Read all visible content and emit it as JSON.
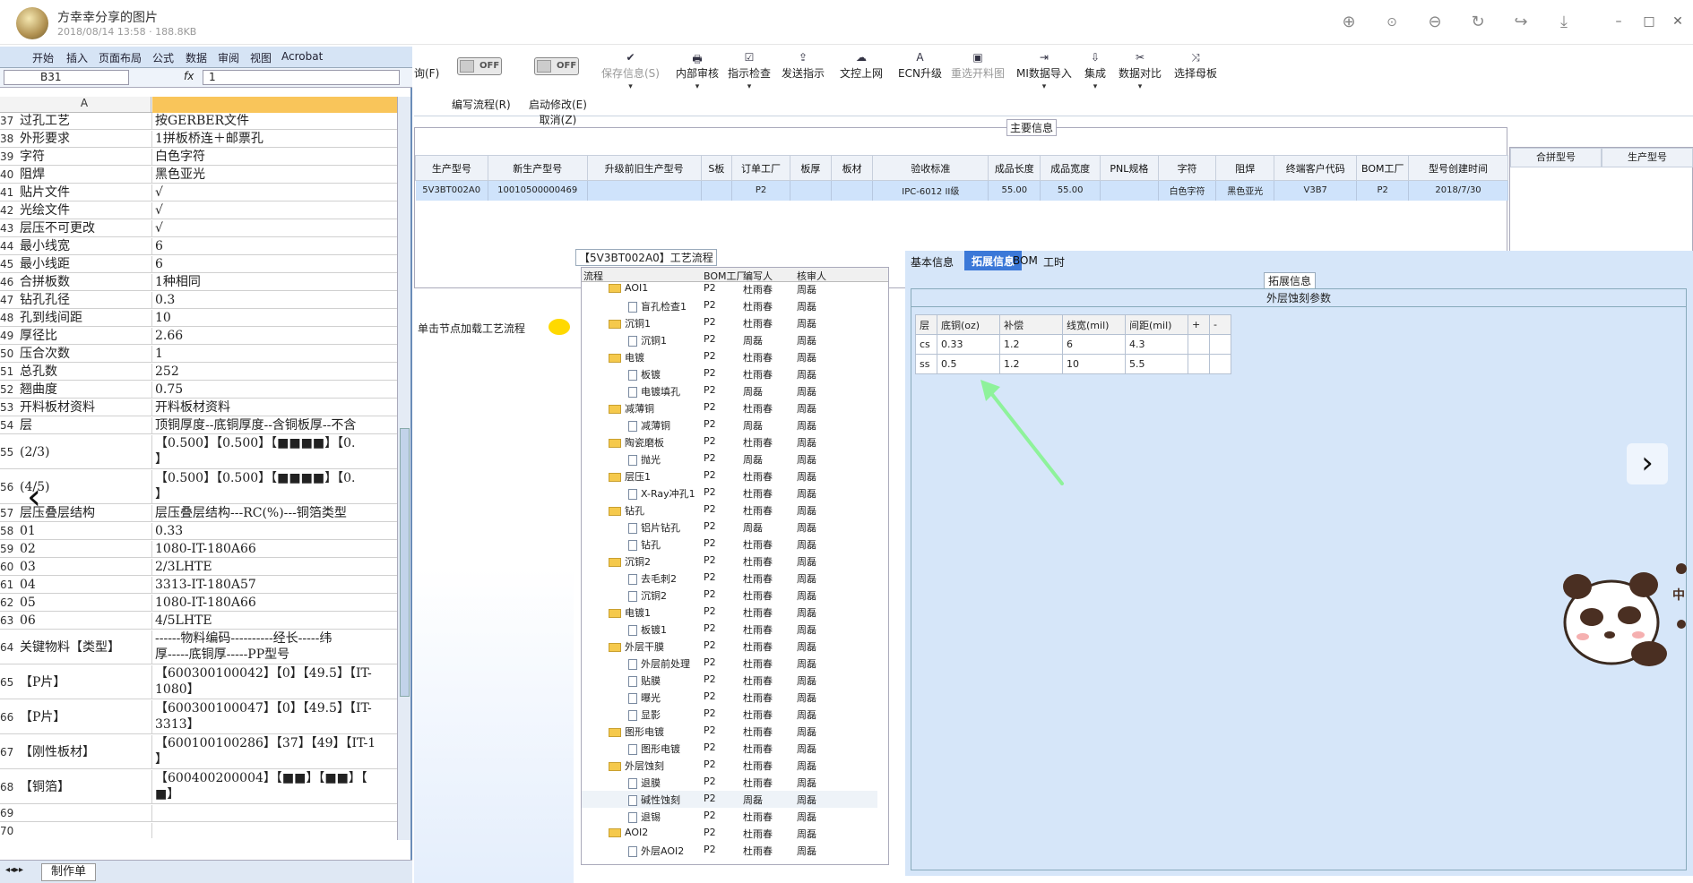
{
  "viewer": {
    "title": "方幸幸分享的图片",
    "meta": "2018/08/14 13:58 · 188.8KB"
  },
  "excel": {
    "ribbon_tabs": [
      "开始",
      "插入",
      "页面布局",
      "公式",
      "数据",
      "审阅",
      "视图",
      "Acrobat"
    ],
    "name_box": "B31",
    "fx": "fx",
    "formula_value": "1",
    "col_a": "A",
    "sheet_tab": "制作单",
    "rows": [
      {
        "n": "37",
        "a": "过孔工艺",
        "b": "按GERBER文件",
        "h": 19
      },
      {
        "n": "38",
        "a": "外形要求",
        "b": "1拼板桥连＋邮票孔",
        "h": 19
      },
      {
        "n": "39",
        "a": "字符",
        "b": "白色字符",
        "h": 19
      },
      {
        "n": "40",
        "a": "阻焊",
        "b": "黑色亚光",
        "h": 19
      },
      {
        "n": "41",
        "a": "贴片文件",
        "b": "√",
        "h": 19
      },
      {
        "n": "42",
        "a": "光绘文件",
        "b": "√",
        "h": 19
      },
      {
        "n": "43",
        "a": "层压不可更改",
        "b": "√",
        "h": 19
      },
      {
        "n": "44",
        "a": "最小线宽",
        "b": "6",
        "h": 19
      },
      {
        "n": "45",
        "a": "最小线距",
        "b": "6",
        "h": 19
      },
      {
        "n": "46",
        "a": "合拼板数",
        "b": "1种相同",
        "h": 19
      },
      {
        "n": "47",
        "a": "钻孔孔径",
        "b": "0.3",
        "h": 19
      },
      {
        "n": "48",
        "a": "孔到线间距",
        "b": "10",
        "h": 19
      },
      {
        "n": "49",
        "a": "厚径比",
        "b": "2.66",
        "h": 19
      },
      {
        "n": "50",
        "a": "压合次数",
        "b": "1",
        "h": 19
      },
      {
        "n": "51",
        "a": "总孔数",
        "b": "252",
        "h": 19
      },
      {
        "n": "52",
        "a": "翘曲度",
        "b": "0.75",
        "h": 19
      },
      {
        "n": "53",
        "a": "开料板材资料",
        "b": "开料板材资料",
        "h": 19
      },
      {
        "n": "54",
        "a": "层",
        "b": "顶铜厚度--底铜厚度--含铜板厚--不含",
        "h": 19
      },
      {
        "n": "55",
        "a": "(2/3)",
        "b": "【0.500】【0.500】【■■■■】【0.\n】",
        "h": 38
      },
      {
        "n": "56",
        "a": "(4/5)",
        "b": "【0.500】【0.500】【■■■■】【0.\n】",
        "h": 38
      },
      {
        "n": "57",
        "a": "层压叠层结构",
        "b": "层压叠层结构---RC(%)---铜箔类型",
        "h": 19
      },
      {
        "n": "58",
        "a": "01",
        "b": "0.33",
        "h": 19
      },
      {
        "n": "59",
        "a": "02",
        "b": "1080-IT-180A66",
        "h": 19
      },
      {
        "n": "60",
        "a": "03",
        "b": "2/3LHTE",
        "h": 19
      },
      {
        "n": "61",
        "a": "04",
        "b": "3313-IT-180A57",
        "h": 19
      },
      {
        "n": "62",
        "a": "05",
        "b": "1080-IT-180A66",
        "h": 19
      },
      {
        "n": "63",
        "a": "06",
        "b": "4/5LHTE",
        "h": 19
      },
      {
        "n": "64",
        "a": "关键物料【类型】",
        "b": "------物料编码----------经长-----纬\n厚-----底铜厚-----PP型号",
        "h": 38
      },
      {
        "n": "65",
        "a": "【P片】",
        "b": "【600300100042】【0】【49.5】【IT-\n1080】",
        "h": 38
      },
      {
        "n": "66",
        "a": "【P片】",
        "b": "【600300100047】【0】【49.5】【IT-\n3313】",
        "h": 38
      },
      {
        "n": "67",
        "a": "【刚性板材】",
        "b": "【600100100286】【37】【49】【IT-1\n】",
        "h": 38
      },
      {
        "n": "68",
        "a": "【铜箔】",
        "b": "【600400200004】【■■】【■■】【\n■】",
        "h": 38
      },
      {
        "n": "69",
        "a": "",
        "b": "",
        "h": 19
      },
      {
        "n": "70",
        "a": "",
        "b": "",
        "h": 19
      },
      {
        "n": "71",
        "a": "",
        "b": "",
        "h": 19
      },
      {
        "n": "72",
        "a": "",
        "b": "",
        "h": 19
      },
      {
        "n": "73",
        "a": "",
        "b": "",
        "h": 19
      }
    ]
  },
  "toolbar": {
    "buttons": [
      {
        "label": "询(F)",
        "icon": "",
        "disabled": false,
        "dd": false
      },
      {
        "label": "编写流程(R)",
        "icon": "",
        "disabled": false,
        "dd": false
      },
      {
        "label": "启动修改(E)",
        "label2": "取消(Z)",
        "icon": "",
        "disabled": false,
        "dd": false
      },
      {
        "label": "保存信息(S)",
        "icon": "✔",
        "disabled": true,
        "dd": true
      },
      {
        "label": "内部审核",
        "icon": "🖶",
        "disabled": false,
        "dd": true
      },
      {
        "label": "指示检查",
        "icon": "☑",
        "disabled": false,
        "dd": true
      },
      {
        "label": "发送指示",
        "icon": "⇪",
        "disabled": false,
        "dd": false
      },
      {
        "label": "文控上网",
        "icon": "☁",
        "disabled": false,
        "dd": false
      },
      {
        "label": "ECN升级",
        "icon": "A",
        "disabled": false,
        "dd": false
      },
      {
        "label": "重选开料图",
        "icon": "▣",
        "disabled": true,
        "dd": false
      },
      {
        "label": "MI数据导入",
        "icon": "⇥",
        "disabled": false,
        "dd": true
      },
      {
        "label": "集成",
        "icon": "⇩",
        "disabled": false,
        "dd": true
      },
      {
        "label": "数据对比",
        "icon": "✂",
        "disabled": false,
        "dd": true
      },
      {
        "label": "选择母板",
        "icon": "⤨",
        "disabled": false,
        "dd": false
      }
    ],
    "toggle_off": "OFF"
  },
  "main_info": {
    "title": "主要信息",
    "headers": [
      "生产型号",
      "新生产型号",
      "升级前旧生产型号",
      "S板",
      "订单工厂",
      "板厚",
      "板材",
      "验收标准",
      "成品长度",
      "成品宽度",
      "PNL规格",
      "字符",
      "阻焊",
      "终端客户代码",
      "BOM工厂",
      "型号创建时间"
    ],
    "row": [
      "5V3BT002A0",
      "10010500000469",
      "",
      "",
      "P2",
      "",
      "",
      "IPC-6012 II级",
      "55.00",
      "55.00",
      "",
      "白色字符",
      "黑色亚光",
      "V3B7",
      "P2",
      "2018/7/30"
    ],
    "side_headers": [
      "合拼型号",
      "生产型号"
    ]
  },
  "flow": {
    "hint": "单击节点加载工艺流程",
    "title": "【5V3BT002A0】工艺流程",
    "headers": [
      "流程",
      "BOM工厂",
      "编写人",
      "核审人"
    ],
    "rows": [
      {
        "t": "f",
        "l": "AOI1",
        "b": "P2",
        "w": "杜雨春",
        "r": "周磊"
      },
      {
        "t": "d",
        "l": "盲孔检查1",
        "b": "P2",
        "w": "杜雨春",
        "r": "周磊"
      },
      {
        "t": "f",
        "l": "沉铜1",
        "b": "P2",
        "w": "杜雨春",
        "r": "周磊"
      },
      {
        "t": "d",
        "l": "沉铜1",
        "b": "P2",
        "w": "周磊",
        "r": "周磊"
      },
      {
        "t": "f",
        "l": "电镀",
        "b": "P2",
        "w": "杜雨春",
        "r": "周磊"
      },
      {
        "t": "d",
        "l": "板镀",
        "b": "P2",
        "w": "杜雨春",
        "r": "周磊"
      },
      {
        "t": "d",
        "l": "电镀填孔",
        "b": "P2",
        "w": "周磊",
        "r": "周磊"
      },
      {
        "t": "f",
        "l": "减薄铜",
        "b": "P2",
        "w": "杜雨春",
        "r": "周磊"
      },
      {
        "t": "d",
        "l": "减薄铜",
        "b": "P2",
        "w": "周磊",
        "r": "周磊"
      },
      {
        "t": "f",
        "l": "陶瓷磨板",
        "b": "P2",
        "w": "杜雨春",
        "r": "周磊"
      },
      {
        "t": "d",
        "l": "抛光",
        "b": "P2",
        "w": "周磊",
        "r": "周磊"
      },
      {
        "t": "f",
        "l": "层压1",
        "b": "P2",
        "w": "杜雨春",
        "r": "周磊"
      },
      {
        "t": "d",
        "l": "X-Ray冲孔1",
        "b": "P2",
        "w": "杜雨春",
        "r": "周磊"
      },
      {
        "t": "f",
        "l": "钻孔",
        "b": "P2",
        "w": "杜雨春",
        "r": "周磊"
      },
      {
        "t": "d",
        "l": "铝片钻孔",
        "b": "P2",
        "w": "周磊",
        "r": "周磊"
      },
      {
        "t": "d",
        "l": "钻孔",
        "b": "P2",
        "w": "杜雨春",
        "r": "周磊"
      },
      {
        "t": "f",
        "l": "沉铜2",
        "b": "P2",
        "w": "杜雨春",
        "r": "周磊"
      },
      {
        "t": "d",
        "l": "去毛刺2",
        "b": "P2",
        "w": "杜雨春",
        "r": "周磊"
      },
      {
        "t": "d",
        "l": "沉铜2",
        "b": "P2",
        "w": "杜雨春",
        "r": "周磊"
      },
      {
        "t": "f",
        "l": "电镀1",
        "b": "P2",
        "w": "杜雨春",
        "r": "周磊"
      },
      {
        "t": "d",
        "l": "板镀1",
        "b": "P2",
        "w": "杜雨春",
        "r": "周磊"
      },
      {
        "t": "f",
        "l": "外层干膜",
        "b": "P2",
        "w": "杜雨春",
        "r": "周磊"
      },
      {
        "t": "d",
        "l": "外层前处理",
        "b": "P2",
        "w": "杜雨春",
        "r": "周磊"
      },
      {
        "t": "d",
        "l": "贴膜",
        "b": "P2",
        "w": "杜雨春",
        "r": "周磊"
      },
      {
        "t": "d",
        "l": "曝光",
        "b": "P2",
        "w": "杜雨春",
        "r": "周磊"
      },
      {
        "t": "d",
        "l": "显影",
        "b": "P2",
        "w": "杜雨春",
        "r": "周磊"
      },
      {
        "t": "f",
        "l": "图形电镀",
        "b": "P2",
        "w": "杜雨春",
        "r": "周磊"
      },
      {
        "t": "d",
        "l": "图形电镀",
        "b": "P2",
        "w": "杜雨春",
        "r": "周磊"
      },
      {
        "t": "f",
        "l": "外层蚀刻",
        "b": "P2",
        "w": "杜雨春",
        "r": "周磊"
      },
      {
        "t": "d",
        "l": "退膜",
        "b": "P2",
        "w": "杜雨春",
        "r": "周磊"
      },
      {
        "t": "d",
        "l": "碱性蚀刻",
        "b": "P2",
        "w": "周磊",
        "r": "周磊",
        "sel": true
      },
      {
        "t": "d",
        "l": "退锡",
        "b": "P2",
        "w": "杜雨春",
        "r": "周磊"
      },
      {
        "t": "f",
        "l": "AOI2",
        "b": "P2",
        "w": "杜雨春",
        "r": "周磊"
      },
      {
        "t": "d",
        "l": "外层AOI2",
        "b": "P2",
        "w": "杜雨春",
        "r": "周磊"
      }
    ]
  },
  "detail": {
    "tabs": [
      "基本信息",
      "拓展信息",
      "BOM",
      "工时"
    ],
    "ext_title": "拓展信息",
    "ext_head": "外层蚀刻参数",
    "table_headers": [
      "层",
      "底铜(oz)",
      "补偿",
      "线宽(mil)",
      "间距(mil)",
      "+",
      "-"
    ],
    "table_rows": [
      [
        "cs",
        "0.33",
        "1.2",
        "6",
        "4.3",
        "",
        ""
      ],
      [
        "ss",
        "0.5",
        "1.2",
        "10",
        "5.5",
        "",
        ""
      ]
    ]
  },
  "panda_text": "中",
  "colors": {
    "accent": "#3b78d8",
    "selection": "#cfe3fb",
    "arrow": "#8ef29b"
  }
}
